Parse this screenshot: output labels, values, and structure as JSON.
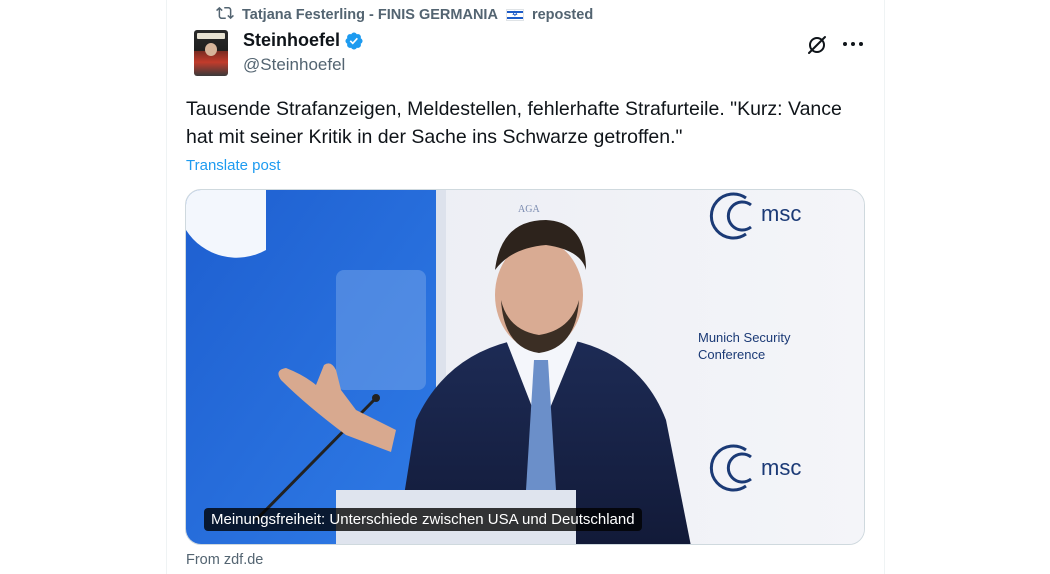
{
  "repost": {
    "user": "Tatjana Festerling - FINIS GERMANIA",
    "action": "reposted"
  },
  "author": {
    "name": "Steinhoefel",
    "handle": "@Steinhoefel"
  },
  "post": {
    "text": "Tausende Strafanzeigen, Meldestellen, fehlerhafte Strafurteile. \"Kurz: Vance hat mit seiner Kritik in der Sache ins Schwarze getroffen.\"",
    "translate_label": "Translate post"
  },
  "media": {
    "caption": "Meinungsfreiheit: Unterschiede zwischen USA und Deutschland",
    "backdrop_text_msc": "msc",
    "backdrop_text_conference": "Munich Security\nConference"
  },
  "source": "From zdf.de",
  "colors": {
    "accent": "#1d9bf0",
    "secondary_text": "#536471",
    "primary_text": "#0f1419"
  }
}
